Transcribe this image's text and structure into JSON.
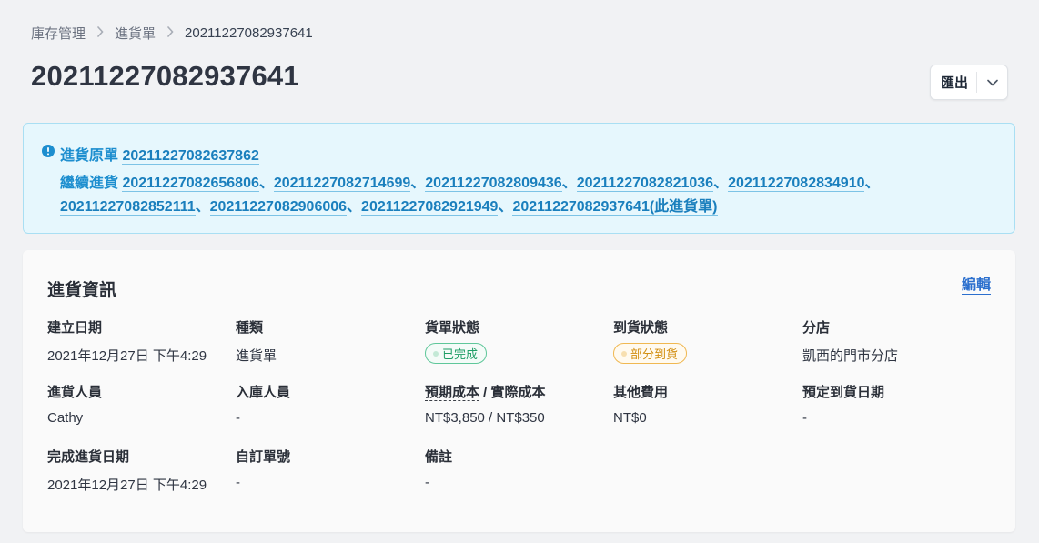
{
  "breadcrumb": {
    "items": [
      "庫存管理",
      "進貨單",
      "20211227082937641"
    ]
  },
  "page_title": "20211227082937641",
  "export_button": {
    "label": "匯出"
  },
  "alert": {
    "origin_prefix": "進貨原單",
    "origin_id": "20211227082637862",
    "continue_prefix": "繼續進貨",
    "continue_ids": [
      "20211227082656806",
      "20211227082714699",
      "20211227082809436",
      "20211227082821036",
      "20211227082834910",
      "20211227082852111",
      "20211227082906006",
      "20211227082921949",
      "20211227082937641(此進貨單)"
    ],
    "separator": "、"
  },
  "card": {
    "title": "進貨資訊",
    "edit_label": "編輯",
    "fields": {
      "created_date": {
        "label": "建立日期",
        "value": "2021年12月27日 下午4:29"
      },
      "type": {
        "label": "種類",
        "value": "進貨單"
      },
      "order_status": {
        "label": "貨單狀態",
        "value": "已完成"
      },
      "arrival_status": {
        "label": "到貨狀態",
        "value": "部分到貨"
      },
      "branch": {
        "label": "分店",
        "value": "凱西的門市分店"
      },
      "purchaser": {
        "label": "進貨人員",
        "value": "Cathy"
      },
      "receiver": {
        "label": "入庫人員",
        "value": "-"
      },
      "cost": {
        "label_expected": "預期成本",
        "label_sep": " / ",
        "label_actual": "實際成本",
        "value": "NT$3,850 / NT$350"
      },
      "other_fees": {
        "label": "其他費用",
        "value": "NT$0"
      },
      "expected_arrival": {
        "label": "預定到貨日期",
        "value": "-"
      },
      "completed_date": {
        "label": "完成進貨日期",
        "value": "2021年12月27日 下午4:29"
      },
      "custom_no": {
        "label": "自訂單號",
        "value": "-"
      },
      "remark": {
        "label": "備註",
        "value": "-"
      }
    }
  },
  "colors": {
    "link": "#1a7fbd",
    "alert_bg": "#e6f7fd",
    "status_green": "#1f9e66",
    "status_orange": "#d28e10",
    "edit_link": "#2b6fce"
  },
  "icons": [
    "chevron-right-icon",
    "chevron-down-icon",
    "info-circle-icon"
  ]
}
